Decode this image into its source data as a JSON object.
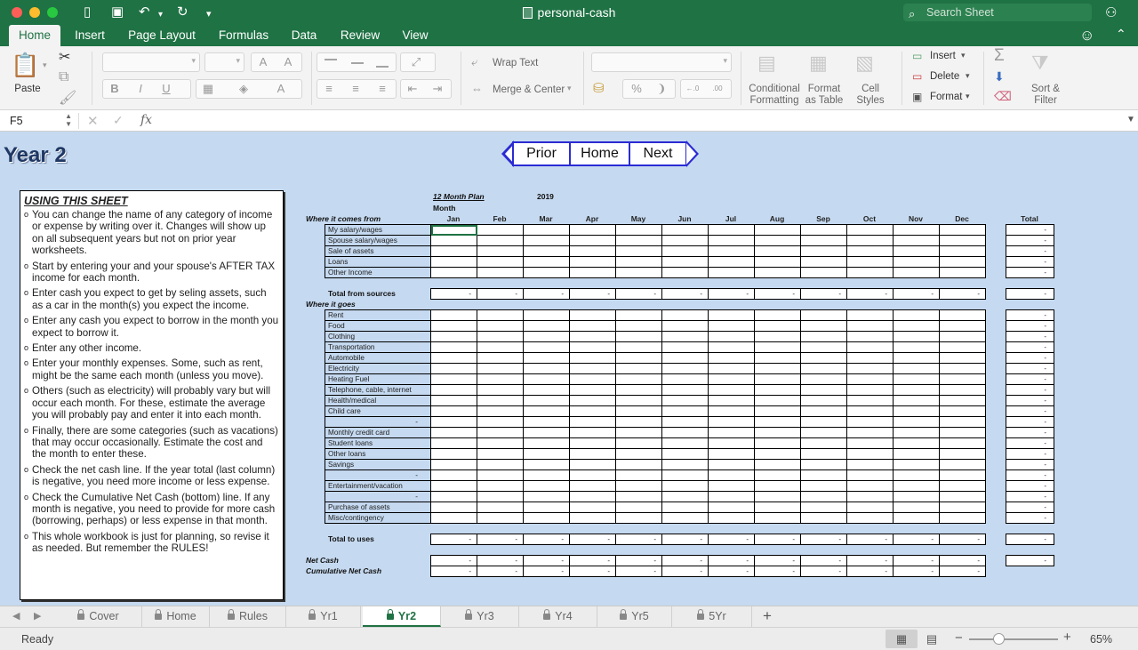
{
  "window": {
    "title": "personal-cash",
    "search_placeholder": "Search Sheet"
  },
  "ribbon_tabs": [
    "Home",
    "Insert",
    "Page Layout",
    "Formulas",
    "Data",
    "Review",
    "View"
  ],
  "ribbon": {
    "paste": "Paste",
    "wrap_text": "Wrap Text",
    "merge_center": "Merge & Center",
    "conditional_formatting": [
      "Conditional",
      "Formatting"
    ],
    "format_as_table": [
      "Format",
      "as Table"
    ],
    "cell_styles": [
      "Cell",
      "Styles"
    ],
    "insert": "Insert",
    "delete": "Delete",
    "format": "Format",
    "sort_filter": [
      "Sort &",
      "Filter"
    ],
    "bold": "B",
    "italic": "I",
    "underline": "U",
    "grow_font": "A",
    "shrink_font": "A",
    "font_color": "A",
    "percent": "%"
  },
  "formula_bar": {
    "name_box": "F5",
    "fx": "fx",
    "value": ""
  },
  "sheet": {
    "year_title": "Year 2",
    "nav": {
      "prior": "Prior",
      "home": "Home",
      "next": "Next"
    },
    "instructions": {
      "heading": "USING THIS SHEET",
      "items": [
        "You can change the name of any category of income or expense by writing over it. Changes will show up on all subsequent years but not on prior year worksheets.",
        "Start by entering your and your spouse's AFTER TAX income for each month.",
        "Enter cash you expect to get by seling assets, such as a car in the month(s) you expect the income.",
        "Enter any cash you expect to borrow in the month you expect to borrow it.",
        "Enter any other income.",
        "Enter your monthly expenses. Some, such as rent, might be the same each month (unless you move).",
        " Others (such as electricity) will probably vary but will occur each month. For these, estimate the average you will probably pay and enter it into each month.",
        "Finally, there are some categories (such as vacations) that may occur occasionally. Estimate the cost and the month to enter these.",
        "Check the net cash line. If the year total (last column) is negative, you need more income or less expense.",
        "Check the Cumulative Net Cash (bottom) line. If any month is negative, you need to provide for more cash (borrowing, perhaps) or less expense in that month.",
        "This whole workbook is just for planning, so revise it as needed. But remember the RULES!"
      ]
    },
    "plan_label": "12 Month Plan",
    "plan_year": "2019",
    "month_label": "Month",
    "months": [
      "Jan",
      "Feb",
      "Mar",
      "Apr",
      "May",
      "Jun",
      "Jul",
      "Aug",
      "Sep",
      "Oct",
      "Nov",
      "Dec"
    ],
    "total_header": "Total",
    "income_header": "Where it comes from",
    "income_rows": [
      "My salary/wages",
      "Spouse salary/wages",
      "Sale of assets",
      "Loans",
      "Other Income"
    ],
    "total_sources_label": "Total from sources",
    "expense_header": "Where it goes",
    "expense_rows": [
      "Rent",
      "Food",
      "Clothing",
      "Transportation",
      "Automobile",
      "Electricity",
      "Heating Fuel",
      "Telephone, cable, internet",
      "Health/medical",
      "Child care",
      "-",
      "Monthly credit card",
      "Student loans",
      "Other loans",
      "Savings",
      "-",
      "Entertainment/vacation",
      "-",
      "Purchase of assets",
      "Misc/contingency"
    ],
    "total_uses_label": "Total to uses",
    "net_cash_label": "Net Cash",
    "cumulative_label": "Cumulative Net Cash",
    "dash": "-"
  },
  "sheet_tabs": [
    "Cover",
    "Home",
    "Rules",
    "Yr1",
    "Yr2",
    "Yr3",
    "Yr4",
    "Yr5",
    "5Yr"
  ],
  "active_sheet": "Yr2",
  "status": {
    "text": "Ready",
    "zoom": "65%"
  },
  "colors": {
    "excel_green": "#1f7244",
    "sheet_bg": "#c5d9f0",
    "nav_border": "#2b2bd3"
  }
}
